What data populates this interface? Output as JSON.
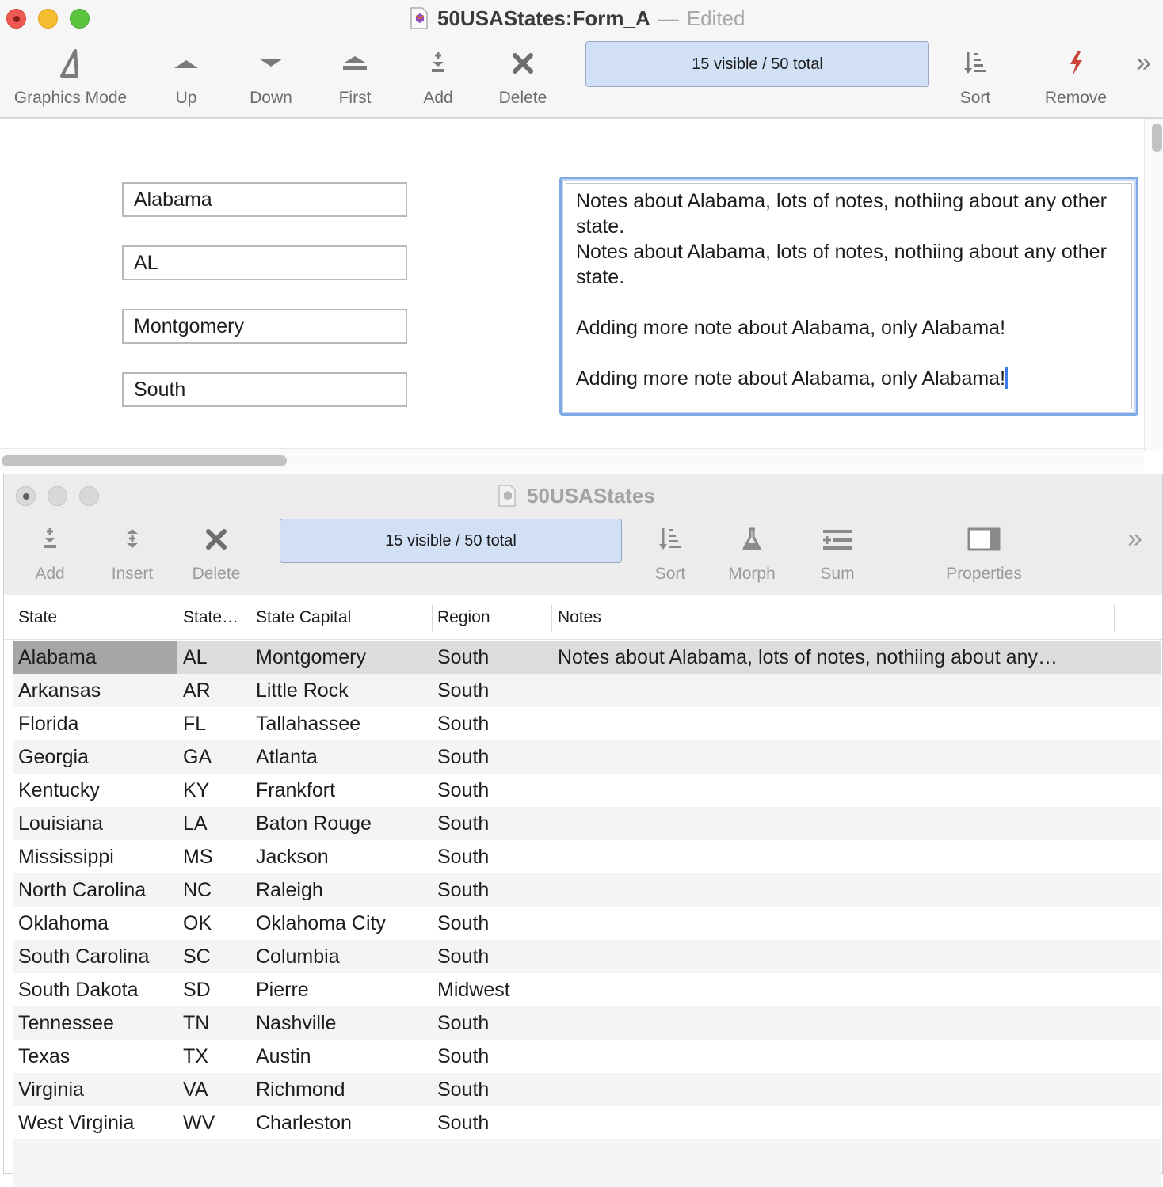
{
  "window_a": {
    "title": "50USAStates:Form_A",
    "title_separator": "—",
    "edited_label": "Edited",
    "toolbar": {
      "graphics_mode": "Graphics Mode",
      "up": "Up",
      "down": "Down",
      "first": "First",
      "add": "Add",
      "delete": "Delete",
      "count": "15 visible / 50 total",
      "sort": "Sort",
      "remove": "Remove"
    },
    "form": {
      "state": "Alabama",
      "abbrev": "AL",
      "capital": "Montgomery",
      "region": "South",
      "notes": "Notes about Alabama, lots of notes, nothiing about any other state.\nNotes about Alabama, lots of notes, nothiing about any other state.\n\nAdding more note about Alabama, only Alabama!\n\nAdding more note about Alabama, only Alabama!"
    }
  },
  "window_b": {
    "title": "50USAStates",
    "toolbar": {
      "add": "Add",
      "insert": "Insert",
      "delete": "Delete",
      "count": "15 visible / 50 total",
      "sort": "Sort",
      "morph": "Morph",
      "sum": "Sum",
      "properties": "Properties"
    },
    "columns": [
      "State",
      "State…",
      "State Capital",
      "Region",
      "Notes"
    ],
    "rows": [
      [
        "Alabama",
        "AL",
        "Montgomery",
        "South",
        "Notes about Alabama, lots of notes, nothiing about any…"
      ],
      [
        "Arkansas",
        "AR",
        "Little Rock",
        "South",
        ""
      ],
      [
        "Florida",
        "FL",
        "Tallahassee",
        "South",
        ""
      ],
      [
        "Georgia",
        "GA",
        "Atlanta",
        "South",
        ""
      ],
      [
        "Kentucky",
        "KY",
        "Frankfort",
        "South",
        ""
      ],
      [
        "Louisiana",
        "LA",
        "Baton Rouge",
        "South",
        ""
      ],
      [
        "Mississippi",
        "MS",
        "Jackson",
        "South",
        ""
      ],
      [
        "North Carolina",
        "NC",
        "Raleigh",
        "South",
        ""
      ],
      [
        "Oklahoma",
        "OK",
        "Oklahoma City",
        "South",
        ""
      ],
      [
        "South Carolina",
        "SC",
        "Columbia",
        "South",
        ""
      ],
      [
        "South Dakota",
        "SD",
        "Pierre",
        "Midwest",
        ""
      ],
      [
        "Tennessee",
        "TN",
        "Nashville",
        "South",
        ""
      ],
      [
        "Texas",
        "TX",
        "Austin",
        "South",
        ""
      ],
      [
        "Virginia",
        "VA",
        "Richmond",
        "South",
        ""
      ],
      [
        "West Virginia",
        "WV",
        "Charleston",
        "South",
        ""
      ]
    ],
    "selected_row": 0
  },
  "colors": {
    "accent": "#3d7ee6",
    "count_fill": "#d2e0f6",
    "remove_icon": "#c8443a",
    "selected_row": "#dcdcdc"
  },
  "icons": [
    "graphics-mode-icon",
    "up-icon",
    "down-icon",
    "first-icon",
    "add-icon",
    "delete-icon",
    "sort-icon",
    "remove-icon",
    "insert-icon",
    "morph-icon",
    "sum-icon",
    "properties-icon",
    "overflow-chevron-icon"
  ]
}
